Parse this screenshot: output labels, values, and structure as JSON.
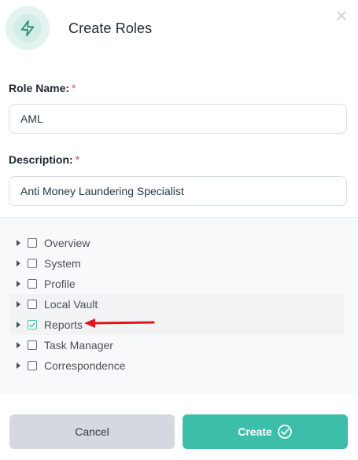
{
  "dialog": {
    "title": "Create Roles",
    "icon": "lightning-icon"
  },
  "form": {
    "role_name": {
      "label": "Role Name:",
      "required_mark": "*",
      "value": "AML"
    },
    "description": {
      "label": "Description:",
      "required_mark": "*",
      "value": "Anti Money Laundering Specialist"
    }
  },
  "permissions": [
    {
      "label": "Overview",
      "checked": false
    },
    {
      "label": "System",
      "checked": false
    },
    {
      "label": "Profile",
      "checked": false
    },
    {
      "label": "Local Vault",
      "checked": false
    },
    {
      "label": "Reports",
      "checked": true
    },
    {
      "label": "Task Manager",
      "checked": false
    },
    {
      "label": "Correspondence",
      "checked": false
    }
  ],
  "buttons": {
    "cancel": "Cancel",
    "create": "Create"
  },
  "colors": {
    "accent": "#3dbeab",
    "required": "#e5484d",
    "annotation_arrow": "#e0161b"
  }
}
